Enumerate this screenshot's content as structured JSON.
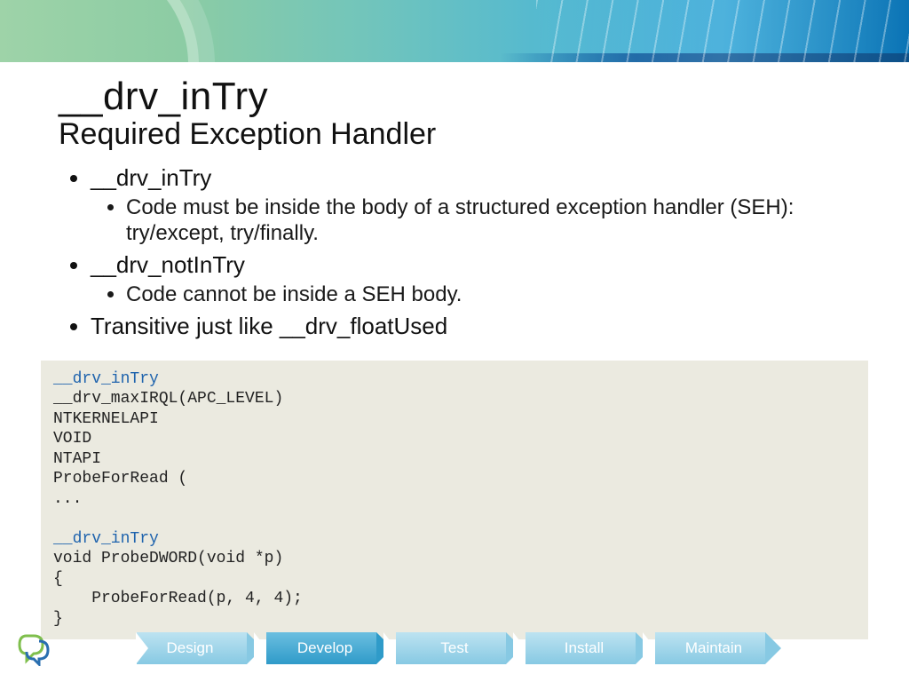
{
  "title": "__drv_inTry",
  "subtitle": "Required Exception Handler",
  "bullets": {
    "b1": "__drv_inTry",
    "b1a": "Code must be inside the body of a structured exception handler (SEH): try/except, try/finally.",
    "b2": "__drv_notInTry",
    "b2a": "Code cannot be inside a SEH body.",
    "b3": "Transitive just like __drv_floatUsed"
  },
  "code": {
    "hl1": "__drv_inTry",
    "l2": "__drv_maxIRQL(APC_LEVEL)",
    "l3": "NTKERNELAPI",
    "l4": "VOID",
    "l5": "NTAPI",
    "l6": "ProbeForRead (",
    "l7": "...",
    "blank": "",
    "hl2": "__drv_inTry",
    "l9": "void ProbeDWORD(void *p)",
    "l10": "{",
    "l11": "    ProbeForRead(p, 4, 4);",
    "l12": "}"
  },
  "footer": {
    "steps": [
      "Design",
      "Develop",
      "Test",
      "Install",
      "Maintain"
    ]
  }
}
